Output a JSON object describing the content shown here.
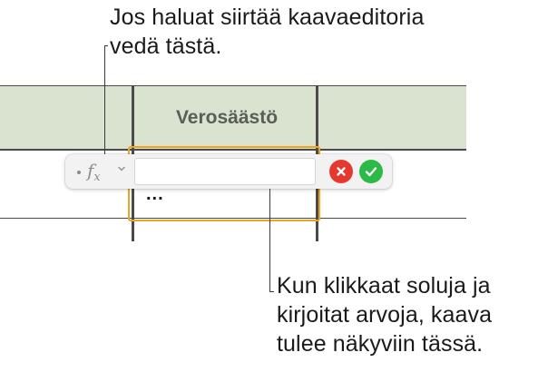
{
  "callouts": {
    "top": {
      "line1": "Jos haluat siirtää kaavaeditoria",
      "line2": "vedä tästä."
    },
    "bottom": {
      "line1": "Kun klikkaat soluja ja",
      "line2": "kirjoitat arvoja, kaava",
      "line3": "tulee näkyviin tässä."
    }
  },
  "table": {
    "header_cell": "Verosäästö",
    "header_bg": "#d9e3d0",
    "selected_cell_value": "...",
    "selection_color": "#f0a31e"
  },
  "formula_editor": {
    "fx_symbol": "f",
    "fx_subscript": "x",
    "formula_value": "",
    "icons": {
      "drag": "drag-handle-icon",
      "chevron": "chevron-down-icon",
      "cancel": "cancel-icon",
      "accept": "checkmark-icon"
    },
    "cancel_color": "#e5392f",
    "accept_color": "#2bba48"
  }
}
